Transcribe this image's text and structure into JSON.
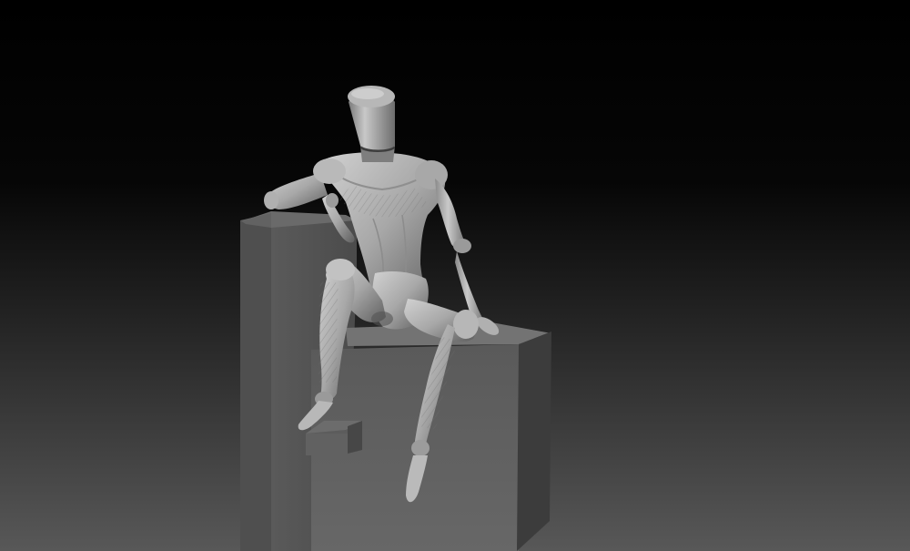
{
  "scene": {
    "background_top": "#000000",
    "background_bottom": "#5a5a5a",
    "material_light": "#bdbdbd",
    "material_mid": "#8a8a8a",
    "material_dark": "#4a4a4a",
    "block_top": "#6e6e6e",
    "block_front": "#5c5c5c",
    "block_side": "#3e3e3e"
  }
}
